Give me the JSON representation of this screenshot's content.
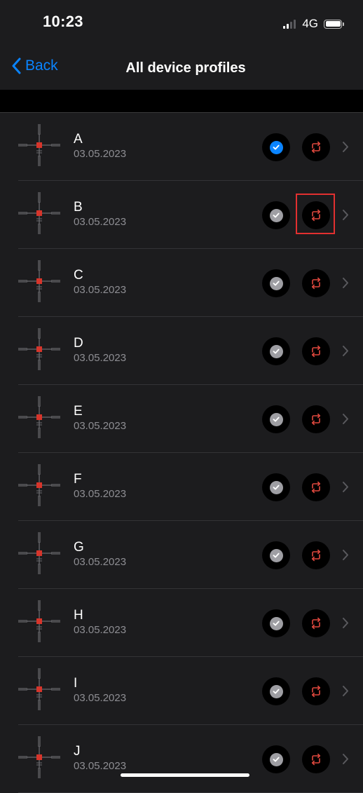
{
  "status_bar": {
    "time": "10:23",
    "network": "4G",
    "signal_bars_active": 2,
    "signal_bars_total": 4
  },
  "nav": {
    "back_label": "Back",
    "title": "All device profiles"
  },
  "profiles": [
    {
      "name": "A",
      "date": "03.05.2023",
      "selected": true,
      "highlighted": false
    },
    {
      "name": "B",
      "date": "03.05.2023",
      "selected": false,
      "highlighted": true
    },
    {
      "name": "C",
      "date": "03.05.2023",
      "selected": false,
      "highlighted": false
    },
    {
      "name": "D",
      "date": "03.05.2023",
      "selected": false,
      "highlighted": false
    },
    {
      "name": "E",
      "date": "03.05.2023",
      "selected": false,
      "highlighted": false
    },
    {
      "name": "F",
      "date": "03.05.2023",
      "selected": false,
      "highlighted": false
    },
    {
      "name": "G",
      "date": "03.05.2023",
      "selected": false,
      "highlighted": false
    },
    {
      "name": "H",
      "date": "03.05.2023",
      "selected": false,
      "highlighted": false
    },
    {
      "name": "I",
      "date": "03.05.2023",
      "selected": false,
      "highlighted": false
    },
    {
      "name": "J",
      "date": "03.05.2023",
      "selected": false,
      "highlighted": false
    }
  ],
  "icons": {
    "select": "checkmark-circle-icon",
    "sync": "sync-arrows-icon",
    "disclosure": "chevron-right-icon",
    "thumbnail": "device-profile-thumbnail"
  },
  "colors": {
    "background": "#1c1c1e",
    "accent_blue": "#0a84ff",
    "sync_red": "#e0483e",
    "annotation_red": "#e23030"
  }
}
